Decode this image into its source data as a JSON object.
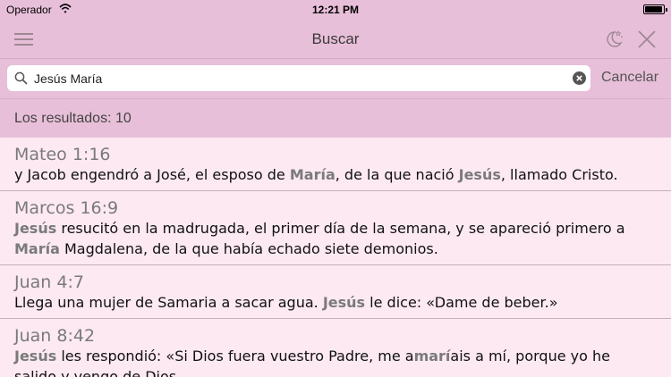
{
  "status_bar": {
    "carrier": "Operador",
    "time": "12:21 PM"
  },
  "nav": {
    "title": "Buscar"
  },
  "search": {
    "value": "Jesús María",
    "cancel_label": "Cancelar"
  },
  "results_count": "Los resultados: 10",
  "results": [
    {
      "reference": "Mateo 1:16",
      "segments": [
        {
          "t": "y Jacob engendró a José, el esposo de "
        },
        {
          "t": "María",
          "hl": true
        },
        {
          "t": ", de la que nació "
        },
        {
          "t": "Jesús",
          "hl": true
        },
        {
          "t": ", llamado Cristo."
        }
      ]
    },
    {
      "reference": "Marcos 16:9",
      "segments": [
        {
          "t": "Jesús",
          "hl": true
        },
        {
          "t": " resucitó en la madrugada, el primer día de la semana, y se apareció primero a "
        },
        {
          "t": "María",
          "hl": true
        },
        {
          "t": " Magdalena, de la que había echado siete demonios."
        }
      ]
    },
    {
      "reference": "Juan 4:7",
      "segments": [
        {
          "t": "Llega una mujer de Samaria a sacar agua. "
        },
        {
          "t": "Jesús",
          "hl": true
        },
        {
          "t": " le dice: «Dame de beber.»"
        }
      ]
    },
    {
      "reference": "Juan 8:42",
      "segments": [
        {
          "t": "Jesús",
          "hl": true
        },
        {
          "t": " les respondió: «Si Dios fuera vuestro Padre, me a"
        },
        {
          "t": "marí",
          "hl": true
        },
        {
          "t": "ais a mí, porque yo he salido y vengo de Dios."
        }
      ]
    }
  ],
  "colors": {
    "bar": "#e8bfd9",
    "list_bg": "#fde9f2",
    "highlight": "#7a7a7a"
  }
}
